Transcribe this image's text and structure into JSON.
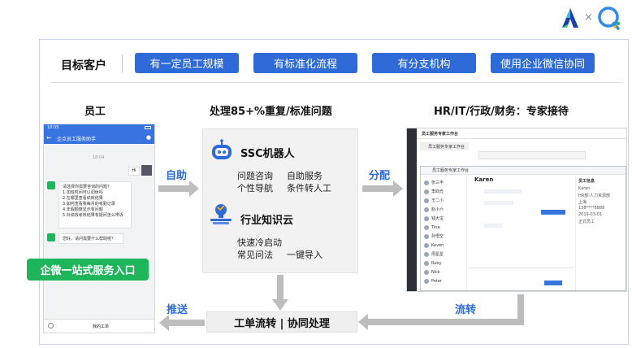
{
  "header": {
    "title": "目标客户",
    "pills": [
      "有一定员工规模",
      "有标准化流程",
      "有分支机构",
      "使用企业微信协同"
    ]
  },
  "columns": {
    "employee": "员工",
    "processing": "处理85+%重复/标准问题",
    "experts": "HR/IT/行政/财务：专家接待"
  },
  "phone": {
    "time": "18:05",
    "app_title": "企点员工服务助手",
    "chat_time": "18:04",
    "user_msg": "Hi",
    "bot_intro": "请选择你需要咨询的问题?",
    "bot_options": [
      "1.加班时间可以调休吗",
      "2.在哪里查看绩效结果",
      "3.如何查看我每月的考勤记录",
      "4.年假额度显示有问题",
      "5.对绩效考核结果有疑问怎么申诉"
    ],
    "bot_followup": "您好，请问需要什么帮助呢？",
    "bottom_label": "我的工单",
    "banner": "企微一站式服务入口"
  },
  "robot": {
    "title": "SSC机器人",
    "items": [
      "问题咨询",
      "自助服务",
      "个性导航",
      "条件转人工"
    ]
  },
  "kb": {
    "title": "行业知识云",
    "items": [
      "快速冷启动",
      "常见问法",
      "一键导入"
    ]
  },
  "arrows": {
    "self_service": "自助",
    "assign": "分配",
    "push": "推送",
    "flow": "流转"
  },
  "workorder": "工单流转 | 协同处理",
  "desktop": {
    "back_title": "员工服务专家工作台",
    "back_item": "员工服务专家工作台",
    "front_title": "员工服务专家工作台",
    "chat_name": "Karen",
    "contacts": [
      "张三丰",
      "李四光",
      "王二小",
      "赵小六",
      "钱大宝",
      "Tina",
      "孙悟空",
      "Keven",
      "周星星",
      "Ruby",
      "Nick",
      "Peter"
    ],
    "info_title": "员工信息",
    "info_fields": [
      "Karen",
      "HR部-人力资源部",
      "上海",
      "138****8888",
      "2019-03-01",
      "正式员工"
    ]
  },
  "colors": {
    "primary": "#2f6bd8",
    "green": "#1fb55a",
    "arrow_gray": "#bdbdbd",
    "phone_blue": "#3774e0"
  },
  "logo_icons": [
    "brand-a-icon",
    "times-icon",
    "chat-bubble-icon"
  ]
}
